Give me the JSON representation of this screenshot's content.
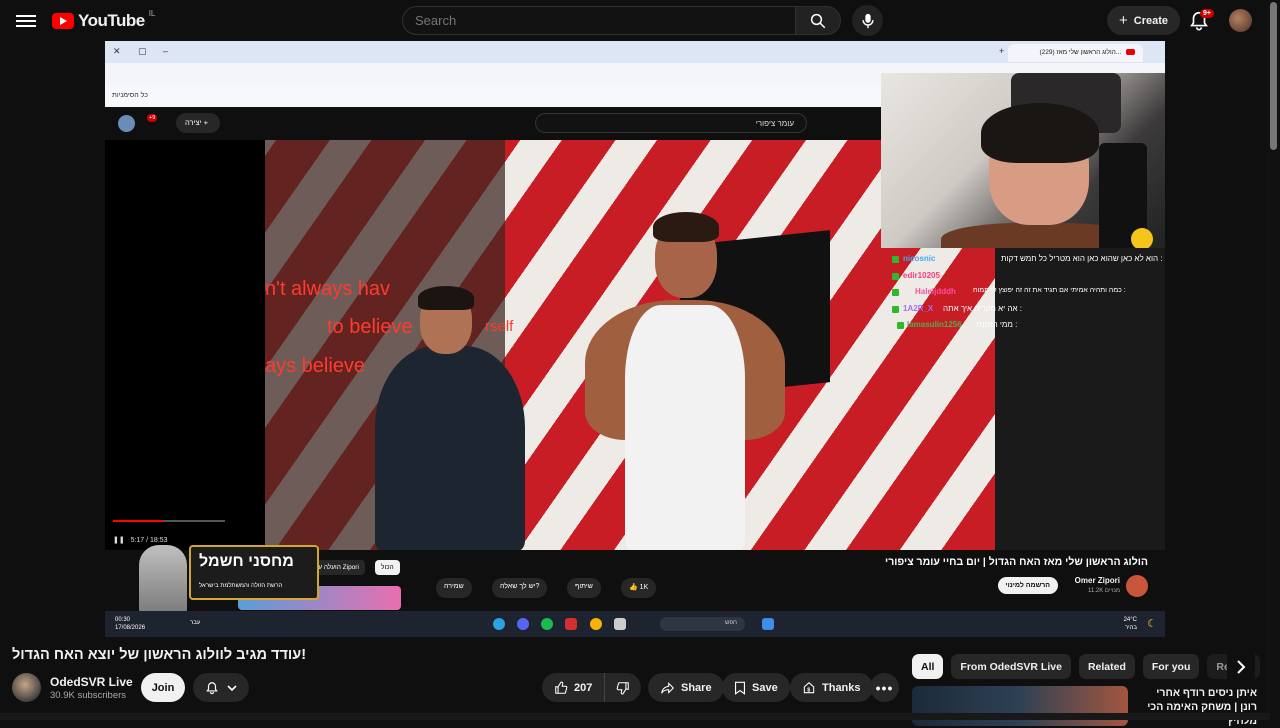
{
  "header": {
    "logo_text": "YouTube",
    "country_code": "IL",
    "search_placeholder": "Search",
    "create_label": "Create",
    "notification_count": "9+"
  },
  "stream": {
    "browser_tab_title": "(229) הולוג הראשון שלי מאז...",
    "bookmarks_label": "כל הסימניות",
    "inner_search_value": "עומר ציפורי",
    "inner_create_label": "יצירה",
    "inner_badge": "+9",
    "wall_text_1": "n't always hav",
    "wall_text_2": "to believe",
    "wall_text_3": "rself",
    "wall_text_4": "ays believe",
    "video_time": "5:17 / 18:53",
    "chat": [
      {
        "user": "nicosnic",
        "color": "#3da9fc",
        "msg": "הוא לא כאן שהוא כאן הוא מטריל כל חמש דקות :"
      },
      {
        "user": "edir10205",
        "color": "#ff3b7a",
        "msg": ""
      },
      {
        "user": "Haleljdddh",
        "color": "#ff4fa3",
        "msg": "כמה ותהיה אמיתי אם תגיד את זה זה יפוצץ לי תמוח :"
      },
      {
        "user": "1A2R_X",
        "color": "#a06ef5",
        "msg": "אה יא מקריח איך אתה :"
      },
      {
        "user": "lamasulin1256",
        "color": "#4caf50",
        "msg": "ממי הזמנת :"
      }
    ],
    "inner_video_title": "הולוג הראשון שלי מאז האח הגדול | יום בחיי עומר ציפורי",
    "inner_channel": "Omer Zipori",
    "inner_subs": "11.2K מנויים",
    "inner_subscribe": "הרשמה למינוי",
    "inner_like": "1K",
    "inner_share": "שיתוף",
    "inner_ask": "יש לך שאלה?",
    "inner_save": "שמירה",
    "inner_chip_all": "הכול",
    "inner_chip_uploaded": "הועלה על ידי Zipori",
    "sponsor_title": "מחסני חשמל",
    "sponsor_sub": "הרשת הזולה והמשתלמת בישראל",
    "taskbar_time": "00:30",
    "taskbar_date": "17/08/2026",
    "taskbar_lang": "עבר",
    "taskbar_search": "חפש",
    "weather_temp": "24°C",
    "weather_desc": "בהיר"
  },
  "video": {
    "title": "עודד מגיב לוולוג הראשון של יוצא האח הגדול!",
    "channel_name": "OdedSVR Live",
    "subscribers": "30.9K subscribers",
    "join_label": "Join",
    "like_count": "207",
    "share_label": "Share",
    "save_label": "Save",
    "thanks_label": "Thanks"
  },
  "chips": [
    "All",
    "From OdedSVR Live",
    "Related",
    "For you",
    "Recent"
  ],
  "recommendation": {
    "title": "איתן ניסים רודף אחרי רונן | משחק האימה הכי מלחיץ"
  },
  "colors": {
    "youtube_red": "#ff0000",
    "background": "#0f0f0f",
    "pill": "#272727"
  }
}
